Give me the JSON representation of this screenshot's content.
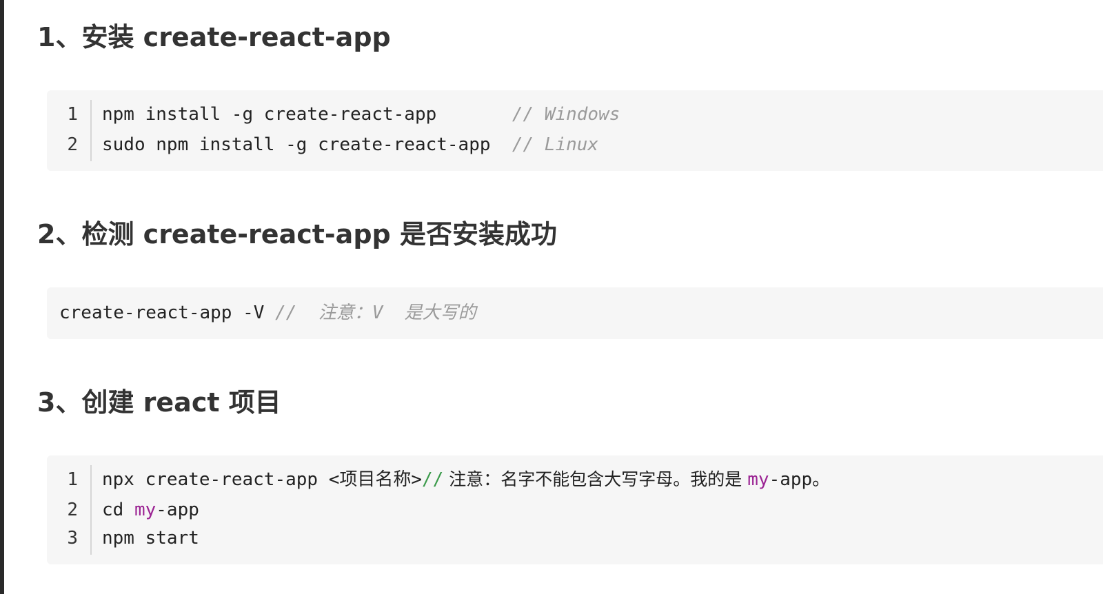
{
  "sections": [
    {
      "heading": "1、安装 create-react-app",
      "lines": [
        {
          "number": "1",
          "code": "npm install -g create-react-app       ",
          "comment": "// Windows"
        },
        {
          "number": "2",
          "code": "sudo npm install -g create-react-app  ",
          "comment": "// Linux"
        }
      ]
    },
    {
      "heading": "2、检测 create-react-app 是否安装成功",
      "lines": [
        {
          "code": "create-react-app -V ",
          "comment": "//  注意：V  是大写的"
        }
      ]
    },
    {
      "heading": "3、创建 react 项目",
      "lines": [
        {
          "number": "1",
          "code": "npx create-react-app <项目名称>",
          "slashes": "//",
          "note": " 注意：名字不能包含大写字母。我的是 ",
          "kw": "my",
          "tail": "-app。"
        },
        {
          "number": "2",
          "code": "cd ",
          "kw": "my",
          "tail": "-app"
        },
        {
          "number": "3",
          "code": "npm start"
        }
      ]
    }
  ],
  "colors": {
    "code_background": "#f6f6f6",
    "comment": "#9a9a9a",
    "comment_slashes": "#3a9a4a",
    "keyword": "#9b2393",
    "heading_text": "#333333"
  }
}
